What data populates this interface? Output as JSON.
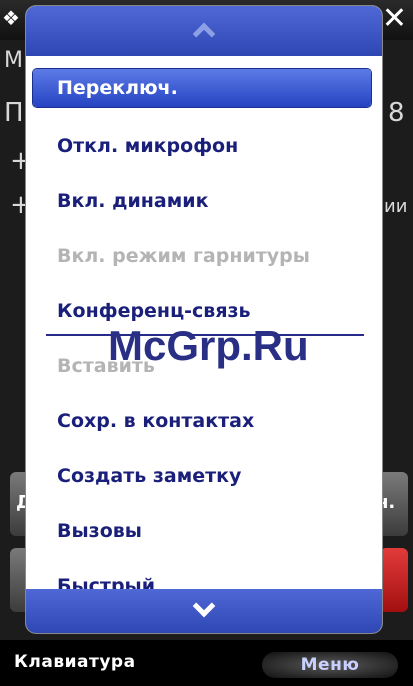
{
  "background": {
    "partial_texts": [
      "M",
      "П",
      "+",
      "+",
      "8",
      "ии",
      "Д",
      "н."
    ]
  },
  "menu": {
    "items": [
      {
        "label": "Переключ.",
        "state": "selected"
      },
      {
        "label": "Откл. микрофон",
        "state": "enabled"
      },
      {
        "label": "Вкл. динамик",
        "state": "enabled"
      },
      {
        "label": "Вкл. режим гарнитуры",
        "state": "disabled"
      },
      {
        "label": "Конференц-связь",
        "state": "enabled"
      },
      {
        "label": "Вставить",
        "state": "disabled"
      },
      {
        "label": "Сохр. в контактах",
        "state": "enabled"
      },
      {
        "label": "Создать заметку",
        "state": "enabled"
      },
      {
        "label": "Вызовы",
        "state": "enabled"
      },
      {
        "label": "Быстрый",
        "state": "enabled"
      }
    ]
  },
  "softkeys": {
    "left": "Клавиатура",
    "right": "Меню"
  },
  "watermark": "McGrp.Ru",
  "colors": {
    "menu_text": "#1a1f7a",
    "disabled_text": "#b4b4b4",
    "selection": "#3452d0",
    "scroll_bar": "#3a52c0"
  }
}
